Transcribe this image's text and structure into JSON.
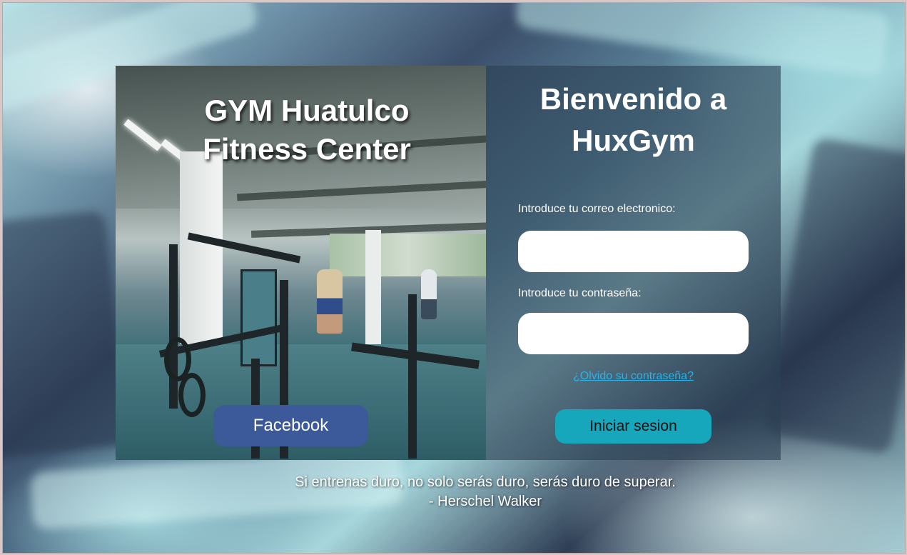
{
  "gym_panel": {
    "title_line1": "GYM Huatulco",
    "title_line2": "Fitness Center",
    "facebook_label": "Facebook"
  },
  "login": {
    "welcome_line1": "Bienvenido a",
    "welcome_line2": "HuxGym",
    "email_label": "Introduce tu correo electronico:",
    "email_value": "",
    "password_label": "Introduce tu contraseña:",
    "password_value": "",
    "forgot_link": "¿Olvido su contraseña?",
    "submit_label": "Iniciar sesion"
  },
  "quote": {
    "text": "Si entrenas duro, no solo serás duro, serás duro de superar.",
    "author": "- Herschel Walker"
  },
  "colors": {
    "facebook": "#3c5a99",
    "submit": "#17a7bd",
    "link": "#29b3e8",
    "panel": "#2c4054"
  },
  "icons": {
    "background": "gym-background-image",
    "photo": "gym-interior-photo"
  }
}
